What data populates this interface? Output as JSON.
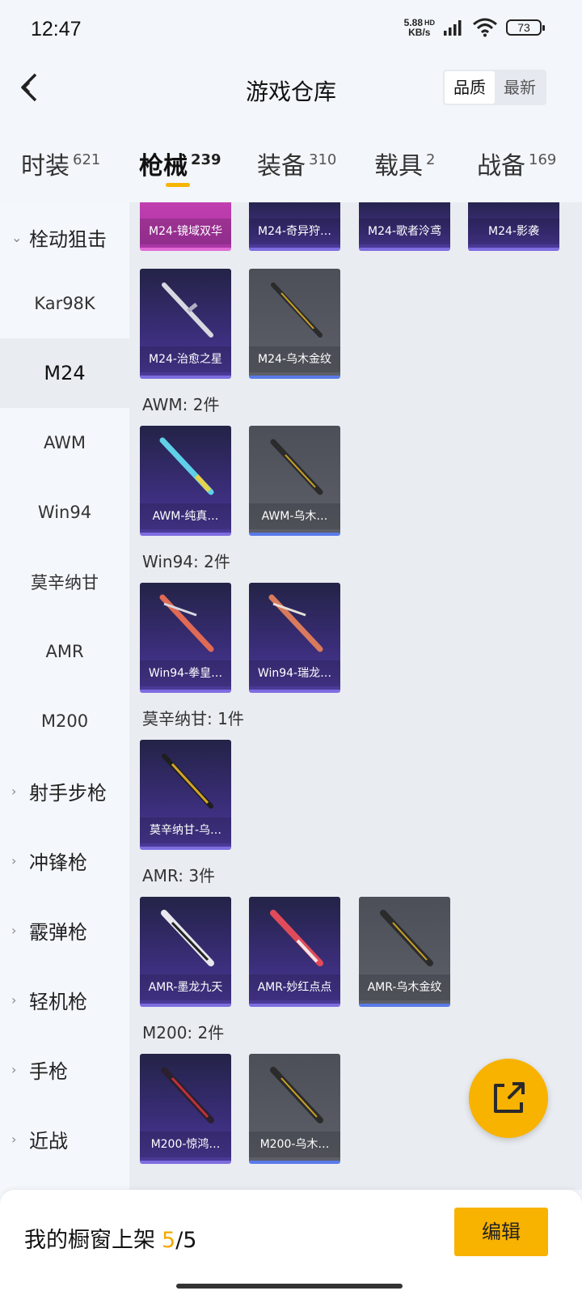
{
  "status": {
    "time": "12:47",
    "speed_top": "5.88",
    "speed_bottom": "KB/s",
    "hd": "HD",
    "battery": "73"
  },
  "header": {
    "title": "游戏仓库",
    "sort_quality": "品质",
    "sort_newest": "最新"
  },
  "tabs": [
    {
      "label": "时装",
      "count": "621"
    },
    {
      "label": "枪械",
      "count": "239"
    },
    {
      "label": "装备",
      "count": "310"
    },
    {
      "label": "载具",
      "count": "2"
    },
    {
      "label": "战备",
      "count": "169"
    }
  ],
  "sidebar": [
    {
      "label": "栓动狙击",
      "chevron": "⌄"
    },
    {
      "label": "Kar98K"
    },
    {
      "label": "M24"
    },
    {
      "label": "AWM"
    },
    {
      "label": "Win94"
    },
    {
      "label": "莫辛纳甘"
    },
    {
      "label": "AMR"
    },
    {
      "label": "M200"
    },
    {
      "label": "射手步枪",
      "chevron": "›"
    },
    {
      "label": "冲锋枪",
      "chevron": "›"
    },
    {
      "label": "霰弹枪",
      "chevron": "›"
    },
    {
      "label": "轻机枪",
      "chevron": "›"
    },
    {
      "label": "手枪",
      "chevron": "›"
    },
    {
      "label": "近战",
      "chevron": "›"
    }
  ],
  "sections": {
    "awm": "AWM: 2件",
    "win94": "Win94: 2件",
    "mosin": "莫辛纳甘: 1件",
    "amr": "AMR: 3件",
    "m200": "M200: 2件"
  },
  "items": {
    "m24_top": [
      "M24-镜域双华",
      "M24-奇异狩…",
      "M24-歌者泠鸢",
      "M24-影袭"
    ],
    "m24": [
      "M24-治愈之星",
      "M24-乌木金纹"
    ],
    "awm": [
      "AWM-纯真…",
      "AWM-乌木…"
    ],
    "win94": [
      "Win94-拳皇…",
      "Win94-瑞龙…"
    ],
    "mosin": [
      "莫辛纳甘-乌…"
    ],
    "amr": [
      "AMR-墨龙九天",
      "AMR-妙红点点",
      "AMR-乌木金纹"
    ],
    "m200": [
      "M200-惊鸿…",
      "M200-乌木…"
    ]
  },
  "footer": {
    "showcase_label": "我的橱窗上架",
    "showcase_used": "5",
    "showcase_total": "/5",
    "edit_label": "编辑"
  },
  "colors": {
    "accent": "#f8b200",
    "card_purple": "#3a2d78",
    "card_gray": "#5c5f68",
    "card_pink": "#c43fb0"
  }
}
